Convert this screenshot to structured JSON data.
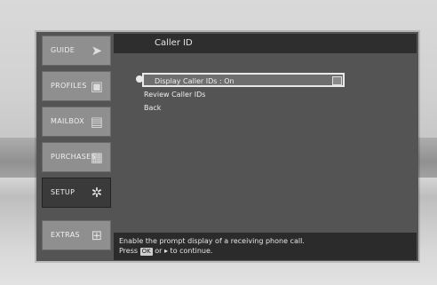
{
  "header": {
    "title": "Caller ID"
  },
  "tabs": [
    {
      "label": "GUIDE",
      "icon": "arrow-right-icon"
    },
    {
      "label": "PROFILES",
      "icon": "profile-icon"
    },
    {
      "label": "MAILBOX",
      "icon": "mailbox-icon"
    },
    {
      "label": "PURCHASES",
      "icon": "purchase-icon"
    },
    {
      "label": "SETUP",
      "icon": "gear-icon"
    },
    {
      "label": "EXTRAS",
      "icon": "grid-icon"
    }
  ],
  "menu": {
    "items": [
      {
        "label": "Display Caller IDs : On"
      },
      {
        "label": "Review Caller IDs"
      },
      {
        "label": "Back"
      }
    ]
  },
  "footer": {
    "line1": "Enable the prompt display of a receiving phone call.",
    "line2_pre": "Press",
    "ok_label": "OK",
    "line2_post": "or ▸ to continue."
  }
}
